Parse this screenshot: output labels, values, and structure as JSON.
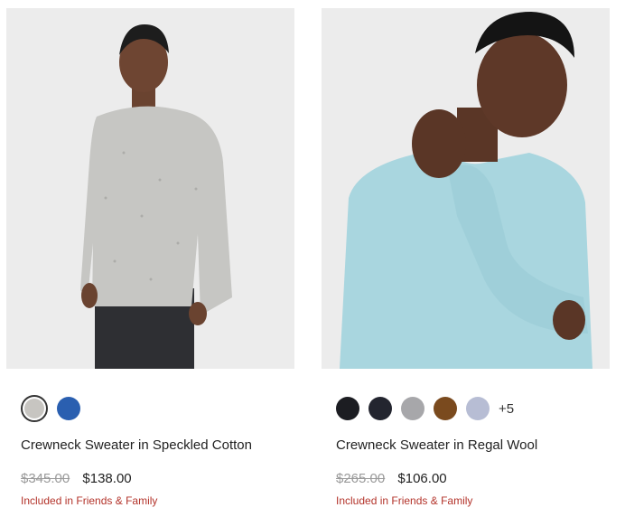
{
  "products": [
    {
      "name": "Crewneck Sweater in Speckled Cotton",
      "original_price": "$345.00",
      "sale_price": "$138.00",
      "promo": "Included in Friends & Family",
      "swatches": [
        {
          "color": "#c7c5c1",
          "selected": true
        },
        {
          "color": "#2a5fb0",
          "selected": false
        }
      ],
      "more_colors": ""
    },
    {
      "name": "Crewneck Sweater in Regal Wool",
      "original_price": "$265.00",
      "sale_price": "$106.00",
      "promo": "Included in Friends & Family",
      "swatches": [
        {
          "color": "#1c1d22",
          "selected": false
        },
        {
          "color": "#23252f",
          "selected": false
        },
        {
          "color": "#a7a7aa",
          "selected": false
        },
        {
          "color": "#7a4a1e",
          "selected": false
        },
        {
          "color": "#b7bdd4",
          "selected": false
        }
      ],
      "more_colors": "+5"
    }
  ],
  "colors": {
    "promo": "#b3332a",
    "strike_price": "#9a9a9a",
    "photo_bg": "#ececec",
    "sweater_grey": "#c6c6c3",
    "sweater_lightblue": "#a9d6df"
  }
}
